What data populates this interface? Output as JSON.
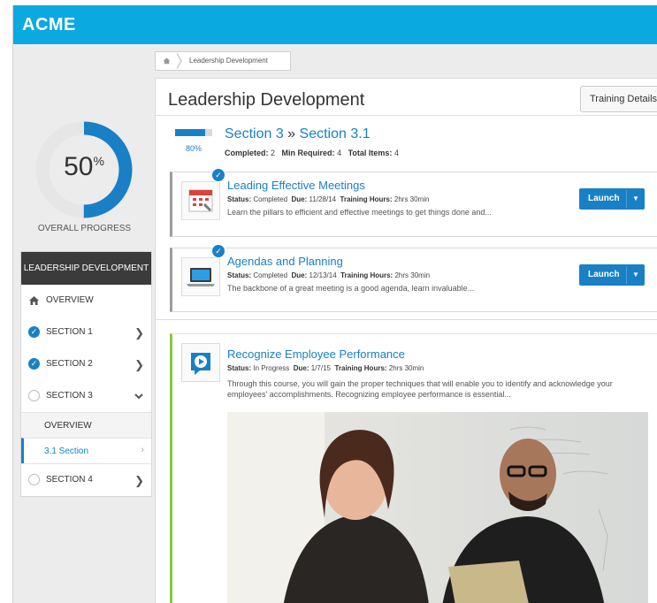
{
  "app": {
    "brand": "ACME"
  },
  "progress": {
    "overall_value": 50,
    "overall_number": "50",
    "overall_unit": "%",
    "overall_label": "OVERALL PROGRESS"
  },
  "nav": {
    "header": "LEADERSHIP DEVELOPMENT",
    "items": [
      {
        "label": "OVERVIEW",
        "icon": "home-icon"
      },
      {
        "label": "SECTION 1",
        "status": "complete"
      },
      {
        "label": "SECTION 2",
        "status": "complete"
      },
      {
        "label": "SECTION 3",
        "status": "incomplete",
        "expanded": true
      },
      {
        "label": "SECTION 4",
        "status": "incomplete"
      }
    ],
    "subitems": [
      {
        "label": "OVERVIEW"
      },
      {
        "label": "3.1 Section",
        "active": true
      }
    ]
  },
  "breadcrumb": {
    "items": [
      "Leadership Development"
    ]
  },
  "main": {
    "title": "Leadership Development",
    "details_button": "Training Details",
    "section": {
      "progress_value": 80,
      "progress_label": "80%",
      "parent": "Section 3",
      "separator": "»",
      "current": "Section 3.1",
      "completed_label": "Completed:",
      "completed_value": "2",
      "min_label": "Min Required:",
      "min_value": "4",
      "total_label": "Total Items:",
      "total_value": "4"
    },
    "items": [
      {
        "title": "Leading Effective Meetings",
        "status_label": "Status:",
        "status": "Completed",
        "due_label": "Due:",
        "due": "11/28/14",
        "hours_label": "Training Hours:",
        "hours": "2hrs 30min",
        "description": "Learn the pillars to efficient and effective meetings to get things done and...",
        "launch": "Launch",
        "icon": "calendar-icon"
      },
      {
        "title": "Agendas and Planning",
        "status_label": "Status:",
        "status": "Completed",
        "due_label": "Due:",
        "due": "12/13/14",
        "hours_label": "Training Hours:",
        "hours": "2hrs 30min",
        "description": "The backbone of a great meeting is a good agenda, learn invaluable...",
        "launch": "Launch",
        "icon": "laptop-icon"
      },
      {
        "title": "Recognize Employee Performance",
        "status_label": "Status:",
        "status": "In Progress",
        "due_label": "Due:",
        "due": "1/7/15",
        "hours_label": "Training Hours:",
        "hours": "2hrs 30min",
        "description": "Through this course, you will gain the proper techniques that will enable you to identify and acknowledge your employees' accomplishments. Recognizing employee performance is essential...",
        "icon": "video-play-icon"
      }
    ]
  },
  "colors": {
    "appbar": "#0aa9e0",
    "accent": "#1980c5",
    "in_progress": "#8cc63f"
  }
}
